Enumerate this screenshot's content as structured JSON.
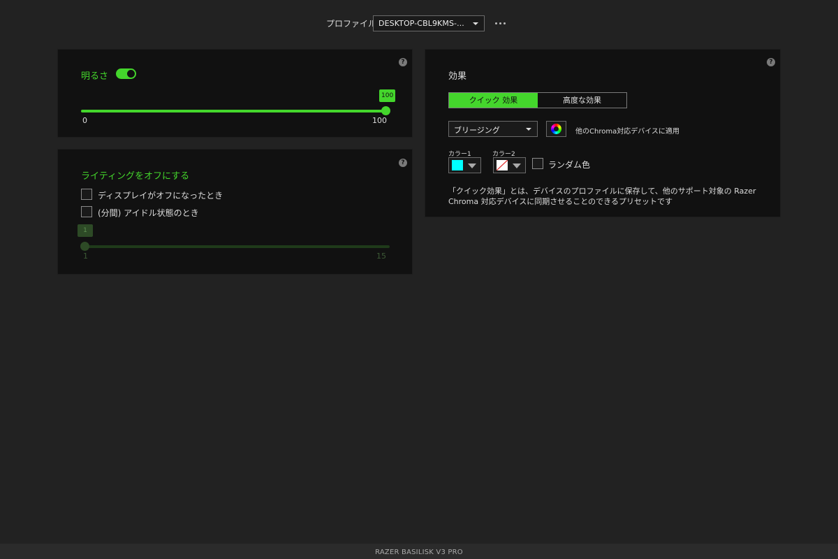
{
  "header": {
    "profile_label": "プロファイル",
    "profile_value": "DESKTOP-CBL9KMS-..."
  },
  "brightness": {
    "title": "明るさ",
    "enabled": true,
    "value": 100,
    "value_label": "100",
    "min_label": "0",
    "max_label": "100",
    "help": "?"
  },
  "lighting_off": {
    "title": "ライティングをオフにする",
    "help": "?",
    "options": [
      {
        "label": "ディスプレイがオフになったとき",
        "checked": false
      },
      {
        "label": "(分間) アイドル状態のとき",
        "checked": false
      }
    ],
    "idle_value": 1,
    "idle_value_label": "1",
    "min_label": "1",
    "max_label": "15"
  },
  "effects": {
    "title": "効果",
    "help": "?",
    "tabs": [
      {
        "label": "クイック 効果",
        "active": true
      },
      {
        "label": "高度な効果",
        "active": false
      }
    ],
    "effect_value": "ブリージング",
    "apply_label": "他のChroma対応デバイスに適用",
    "color1_label": "カラー1",
    "color1": "#00ffff",
    "color2_label": "カラー2",
    "color2": "none",
    "random_label": "ランダム色",
    "description": [
      "「クイック効果」とは、デバイスのプロファイルに保存して、他のサポート対象の Razer",
      "Chroma 対応デバイスに同期させることのできるプリセットです"
    ]
  },
  "footer": {
    "device_name": "RAZER BASILISK V3 PRO"
  },
  "colors": {
    "accent": "#44d62c",
    "panel_bg": "#111111",
    "page_bg": "#222222",
    "disabled_green": "#2d4a26"
  },
  "icons": [
    "chevron-down-icon",
    "more-horizontal-icon",
    "help-icon",
    "color-wheel-icon"
  ]
}
